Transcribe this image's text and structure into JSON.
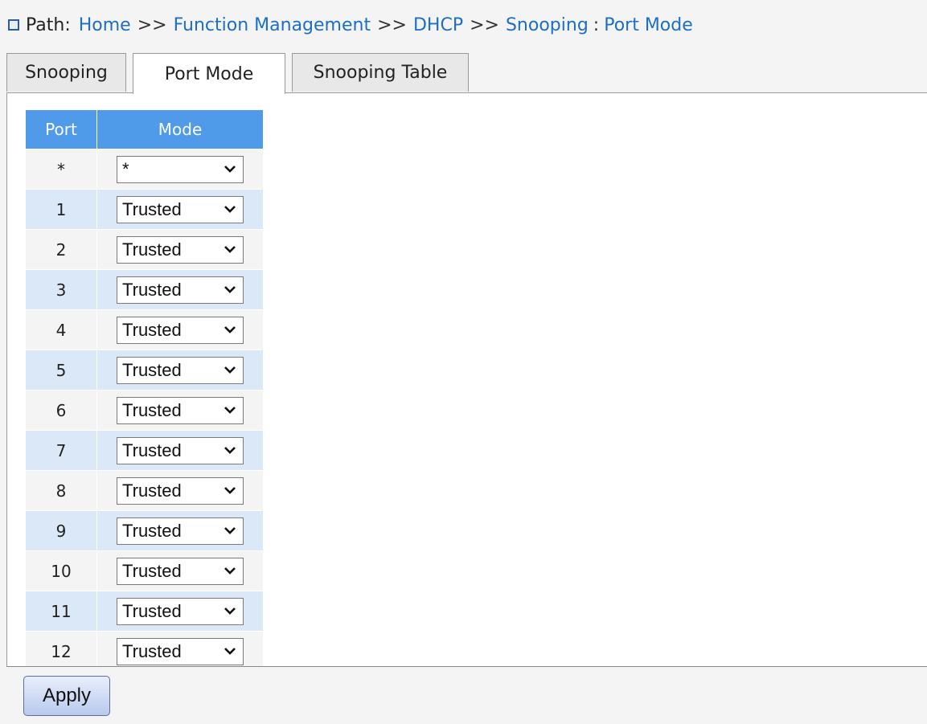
{
  "path": {
    "label": "Path:",
    "crumbs": [
      "Home",
      "Function Management",
      "DHCP",
      "Snooping"
    ],
    "separator": ">>",
    "colon": ":",
    "current": "Port Mode"
  },
  "tabs": [
    {
      "label": "Snooping",
      "active": false
    },
    {
      "label": "Port Mode",
      "active": true
    },
    {
      "label": "Snooping Table",
      "active": false
    }
  ],
  "table": {
    "headers": {
      "port": "Port",
      "mode": "Mode"
    },
    "rows": [
      {
        "port": "*",
        "mode": "*"
      },
      {
        "port": "1",
        "mode": "Trusted"
      },
      {
        "port": "2",
        "mode": "Trusted"
      },
      {
        "port": "3",
        "mode": "Trusted"
      },
      {
        "port": "4",
        "mode": "Trusted"
      },
      {
        "port": "5",
        "mode": "Trusted"
      },
      {
        "port": "6",
        "mode": "Trusted"
      },
      {
        "port": "7",
        "mode": "Trusted"
      },
      {
        "port": "8",
        "mode": "Trusted"
      },
      {
        "port": "9",
        "mode": "Trusted"
      },
      {
        "port": "10",
        "mode": "Trusted"
      },
      {
        "port": "11",
        "mode": "Trusted"
      },
      {
        "port": "12",
        "mode": "Trusted"
      }
    ]
  },
  "apply_label": "Apply",
  "icons": {
    "path": "square-bullet-icon",
    "select": "chevron-down-icon"
  },
  "colors": {
    "header_bg": "#4f9be9",
    "stripe": "#dbe8f8",
    "link": "#1d6fc4"
  }
}
